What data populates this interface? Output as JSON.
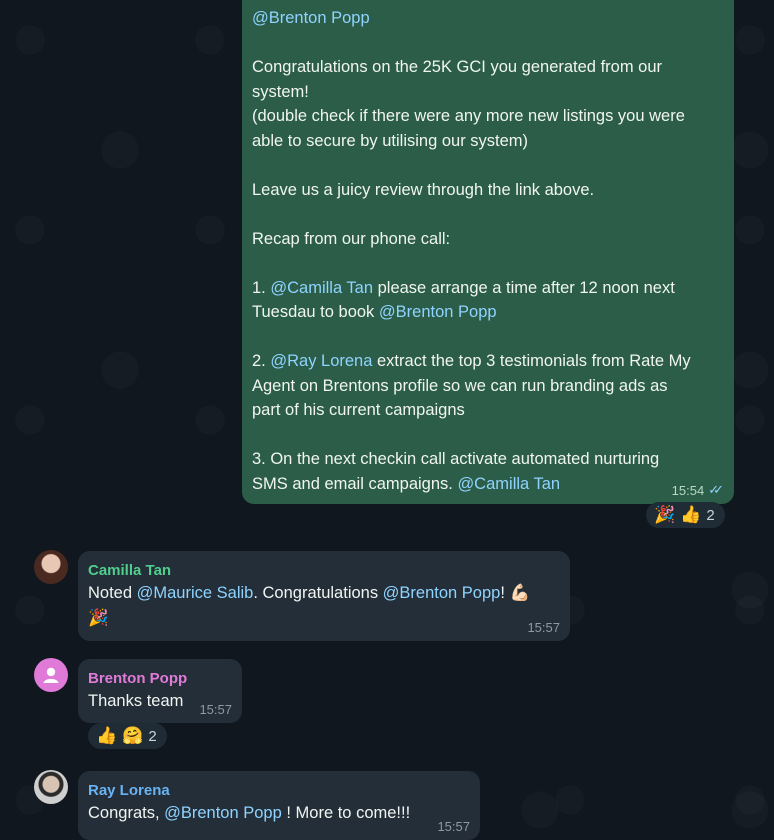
{
  "outgoing": {
    "mention_top": "@Brenton Popp",
    "p1_line1": "Congratulations on the 25K GCI you generated from our",
    "p1_line2": "system!",
    "p1_line3": "(double check if there were any more new listings you were",
    "p1_line4": "able to secure by utilising our system)",
    "p2": "Leave us a juicy review through the link above.",
    "p3": "Recap from our phone call:",
    "item1_prefix": "1. ",
    "item1_mention": "@Camilla Tan",
    "item1_text1": " please arrange a time after 12 noon next",
    "item1_text2": "Tuesdau to book ",
    "item1_mention2": "@Brenton Popp",
    "item2_prefix": "2. ",
    "item2_mention": "@Ray Lorena",
    "item2_text1": " extract the top 3 testimonials from Rate My",
    "item2_text2": "Agent on Brentons profile so we can run branding ads as",
    "item2_text3": "part of his current campaigns",
    "item3_text1": "3. On the next checkin call activate automated nurturing",
    "item3_text2": "SMS and email campaigns. ",
    "item3_mention": "@Camilla Tan",
    "time": "15:54",
    "status_icon": "double-check-icon",
    "reactions": {
      "emoji1": "🎉",
      "emoji2": "👍",
      "count": "2"
    }
  },
  "messages": [
    {
      "sender": "Camilla Tan",
      "sender_color": "#4fce8d",
      "text_before": "Noted ",
      "mention1": "@Maurice Salib",
      "text_mid": ". Congratulations ",
      "mention2": "@Brenton Popp",
      "text_after": "! 💪🏻",
      "line2": "🎉",
      "time": "15:57"
    },
    {
      "sender": "Brenton Popp",
      "sender_color": "#e07ad8",
      "avatar_color": "#e07ad8",
      "avatar_icon": "person-icon",
      "text": "Thanks team",
      "time": "15:57",
      "reactions": {
        "emoji1": "👍",
        "emoji2": "🤗",
        "count": "2"
      }
    },
    {
      "sender": "Ray Lorena",
      "sender_color": "#6ab3f3",
      "text_before": "Congrats, ",
      "mention": "@Brenton Popp",
      "text_after": " ! More to come!!!",
      "time": "15:57"
    }
  ]
}
